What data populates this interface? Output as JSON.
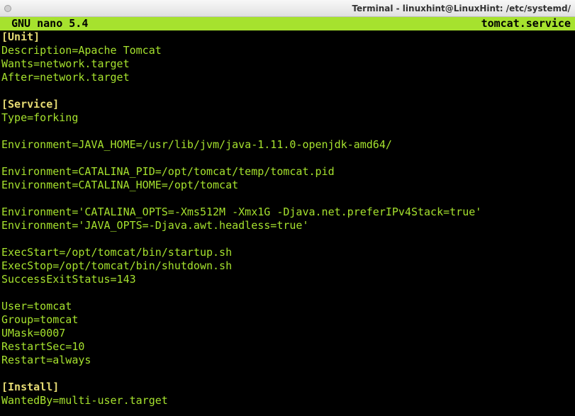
{
  "window": {
    "title": "Terminal - linuxhint@LinuxHint: /etc/systemd/"
  },
  "nano": {
    "app": "GNU nano 5.4",
    "filename": "tomcat.service"
  },
  "file": {
    "unit_header": "[Unit]",
    "unit": {
      "description": "Description=Apache Tomcat",
      "wants": "Wants=network.target",
      "after": "After=network.target"
    },
    "service_header": "[Service]",
    "service": {
      "type": "Type=forking",
      "env_java_home": "Environment=JAVA_HOME=/usr/lib/jvm/java-1.11.0-openjdk-amd64/",
      "env_catalina_pid": "Environment=CATALINA_PID=/opt/tomcat/temp/tomcat.pid",
      "env_catalina_home": "Environment=CATALINA_HOME=/opt/tomcat",
      "env_catalina_opts": "Environment='CATALINA_OPTS=-Xms512M -Xmx1G -Djava.net.preferIPv4Stack=true'",
      "env_java_opts": "Environment='JAVA_OPTS=-Djava.awt.headless=true'",
      "exec_start": "ExecStart=/opt/tomcat/bin/startup.sh",
      "exec_stop": "ExecStop=/opt/tomcat/bin/shutdown.sh",
      "success_exit": "SuccessExitStatus=143",
      "user": "User=tomcat",
      "group": "Group=tomcat",
      "umask": "UMask=0007",
      "restart_sec": "RestartSec=10",
      "restart": "Restart=always"
    },
    "install_header": "[Install]",
    "install": {
      "wanted_by": "WantedBy=multi-user.target"
    }
  }
}
